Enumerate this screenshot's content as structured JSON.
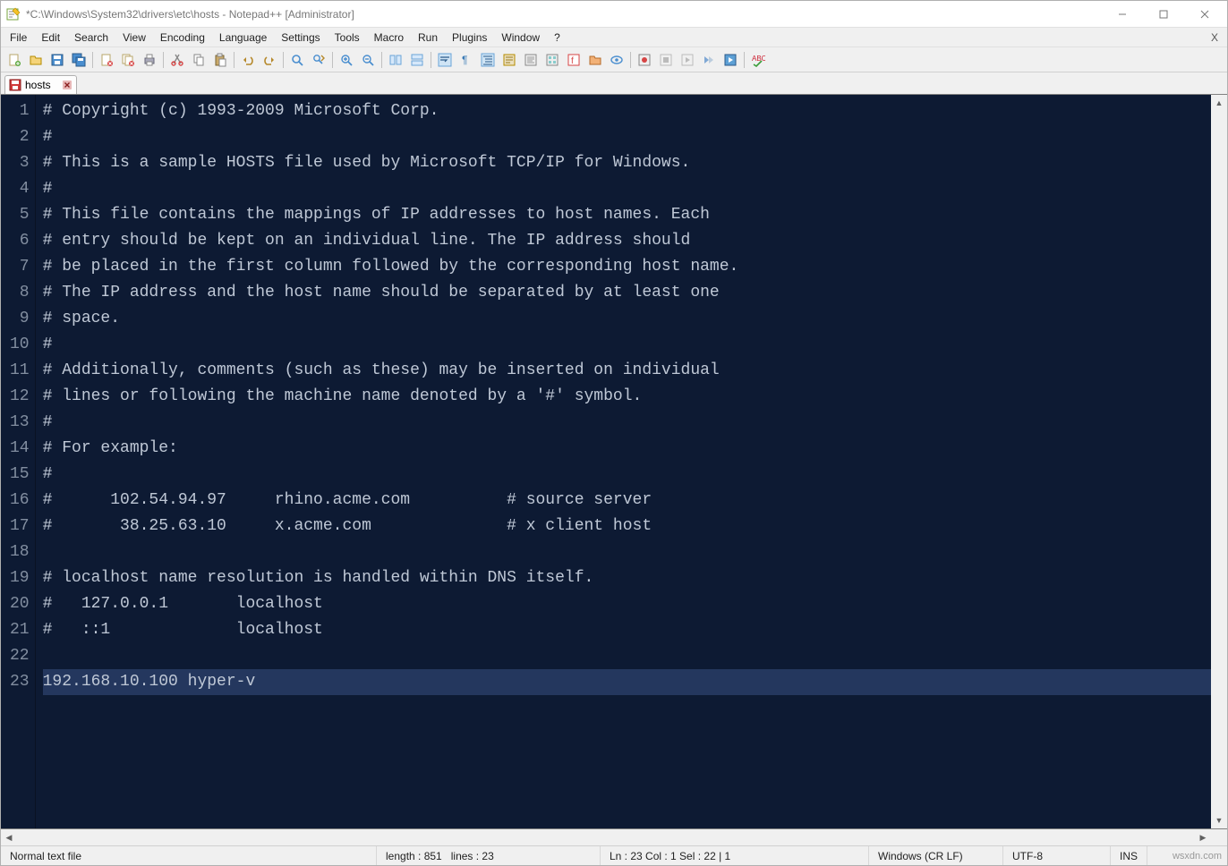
{
  "window": {
    "title": "*C:\\Windows\\System32\\drivers\\etc\\hosts - Notepad++ [Administrator]"
  },
  "menu": [
    "File",
    "Edit",
    "Search",
    "View",
    "Encoding",
    "Language",
    "Settings",
    "Tools",
    "Macro",
    "Run",
    "Plugins",
    "Window",
    "?"
  ],
  "tab": {
    "label": "hosts",
    "modified": true
  },
  "editor": {
    "lines": [
      "# Copyright (c) 1993-2009 Microsoft Corp.",
      "#",
      "# This is a sample HOSTS file used by Microsoft TCP/IP for Windows.",
      "#",
      "# This file contains the mappings of IP addresses to host names. Each",
      "# entry should be kept on an individual line. The IP address should",
      "# be placed in the first column followed by the corresponding host name.",
      "# The IP address and the host name should be separated by at least one",
      "# space.",
      "#",
      "# Additionally, comments (such as these) may be inserted on individual",
      "# lines or following the machine name denoted by a '#' symbol.",
      "#",
      "# For example:",
      "#",
      "#      102.54.94.97     rhino.acme.com          # source server",
      "#       38.25.63.10     x.acme.com              # x client host",
      "",
      "# localhost name resolution is handled within DNS itself.",
      "#   127.0.0.1       localhost",
      "#   ::1             localhost",
      "",
      "192.168.10.100 hyper-v"
    ],
    "highlighted_line_index": 22
  },
  "status": {
    "filetype": "Normal text file",
    "length_label": "length : 851",
    "lines_label": "lines : 23",
    "position": "Ln : 23   Col : 1   Sel : 22 | 1",
    "eol": "Windows (CR LF)",
    "encoding": "UTF-8",
    "mode": "INS"
  },
  "watermark": "wsxdn.com"
}
